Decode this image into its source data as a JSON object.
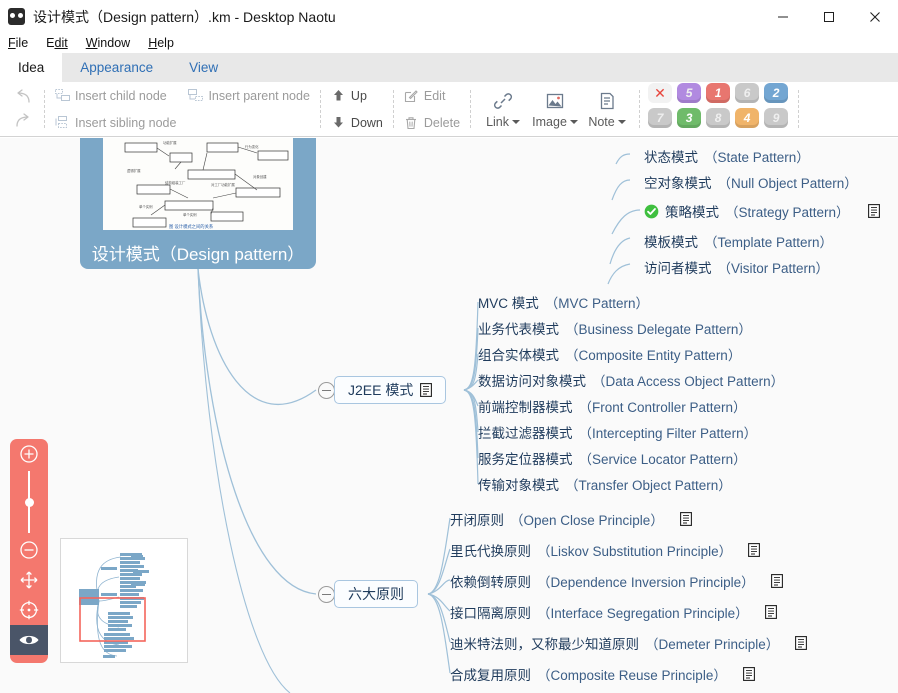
{
  "window": {
    "title": "设计模式（Design pattern）.km - Desktop Naotu",
    "logo_icon": "owl-logo-icon",
    "minimize_label": "—",
    "maximize_label": "□",
    "close_label": "✕"
  },
  "menubar": {
    "items": [
      {
        "first": "F",
        "rest": "ile"
      },
      {
        "first": "E",
        "rest": "dit"
      },
      {
        "first": "W",
        "rest": "indow"
      },
      {
        "first": "H",
        "rest": "elp"
      }
    ]
  },
  "tabs": [
    {
      "label": "Idea",
      "active": true
    },
    {
      "label": "Appearance",
      "active": false
    },
    {
      "label": "View",
      "active": false
    }
  ],
  "ribbon": {
    "undo_icon": "undo-arrow-icon",
    "redo_icon": "redo-arrow-icon",
    "insert_child": "Insert child node",
    "insert_parent": "Insert parent node",
    "insert_sibling": "Insert sibling node",
    "up": "Up",
    "down": "Down",
    "edit": "Edit",
    "delete": "Delete",
    "link": "Link",
    "image": "Image",
    "note": "Note",
    "priority": {
      "clear_label": "✕",
      "active": [
        "1",
        "2",
        "3",
        "4",
        "5"
      ],
      "inactive": [
        "6",
        "7",
        "8",
        "9"
      ],
      "colors": {
        "1": "#e8766f",
        "2": "#73a6d2",
        "3": "#6fbb6a",
        "4": "#f0b46a",
        "5": "#b18ae0",
        "inactive": "#c9c9c9",
        "clear": "#e8453c"
      }
    }
  },
  "mindmap": {
    "root": {
      "title": "设计模式（Design pattern）",
      "image_caption": "图 设计模式之间的关系",
      "fill_color": "#7ba7c7"
    },
    "branches": [
      {
        "id": "patterns-top",
        "collapsed": false,
        "children": [
          {
            "cn": "状态模式",
            "en": "（State Pattern）",
            "note": false,
            "check": false
          },
          {
            "cn": "空对象模式",
            "en": "（Null Object Pattern）",
            "note": false,
            "check": false
          },
          {
            "cn": "策略模式",
            "en": "（Strategy Pattern）",
            "note": true,
            "check": true
          },
          {
            "cn": "模板模式",
            "en": "（Template Pattern）",
            "note": false,
            "check": false
          },
          {
            "cn": "访问者模式",
            "en": "（Visitor Pattern）",
            "note": false,
            "check": false
          }
        ]
      },
      {
        "id": "j2ee",
        "label": "J2EE 模式",
        "note": true,
        "collapsed": false,
        "children": [
          {
            "cn": "MVC 模式",
            "en": "（MVC Pattern）",
            "note": false
          },
          {
            "cn": "业务代表模式",
            "en": "（Business Delegate Pattern）",
            "note": false
          },
          {
            "cn": "组合实体模式",
            "en": "（Composite Entity Pattern）",
            "note": false
          },
          {
            "cn": "数据访问对象模式",
            "en": "（Data Access Object Pattern）",
            "note": false
          },
          {
            "cn": "前端控制器模式",
            "en": "（Front Controller Pattern）",
            "note": false
          },
          {
            "cn": "拦截过滤器模式",
            "en": "（Intercepting Filter Pattern）",
            "note": false
          },
          {
            "cn": "服务定位器模式",
            "en": "（Service Locator Pattern）",
            "note": false
          },
          {
            "cn": "传输对象模式",
            "en": "（Transfer Object Pattern）",
            "note": false
          }
        ]
      },
      {
        "id": "six-principles",
        "label": "六大原则",
        "note": false,
        "collapsed": false,
        "children": [
          {
            "cn": "开闭原则",
            "en": "（Open Close Principle）",
            "note": true
          },
          {
            "cn": "里氏代换原则",
            "en": "（Liskov Substitution Principle）",
            "note": true
          },
          {
            "cn": "依赖倒转原则",
            "en": "（Dependence Inversion Principle）",
            "note": true
          },
          {
            "cn": "接口隔离原则",
            "en": "（Interface Segregation Principle）",
            "note": true
          },
          {
            "cn": "迪米特法则，又称最少知道原则",
            "en": "（Demeter Principle）",
            "note": true
          },
          {
            "cn": "合成复用原则",
            "en": "（Composite Reuse Principle）",
            "note": true
          }
        ]
      }
    ]
  },
  "zoom_panel": {
    "zoom_in_icon": "zoom-in-icon",
    "zoom_out_icon": "zoom-out-icon",
    "move_icon": "move-icon",
    "center_icon": "center-target-icon",
    "eye_icon": "eye-icon",
    "background_color": "#f4786e",
    "active_color": "#4a5568"
  },
  "minimap": {
    "viewport_color": "#f4665c",
    "node_color": "#7ba7c7"
  }
}
